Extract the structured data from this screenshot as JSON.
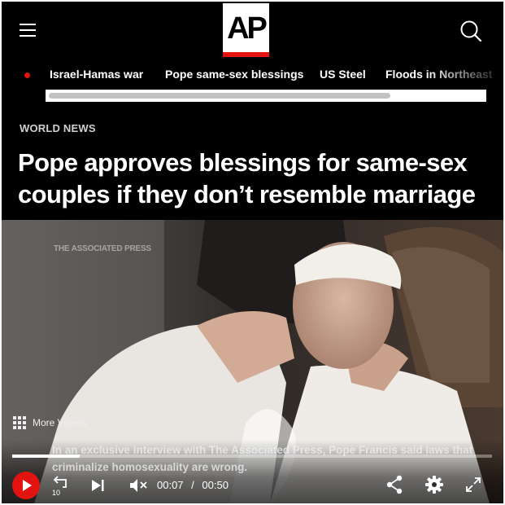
{
  "header": {
    "logo_text": "AP",
    "logo_accent": "#e3140f",
    "menu_icon": "hamburger-icon",
    "search_icon": "search-icon"
  },
  "trending": {
    "items": [
      "Israel-Hamas war",
      "Pope same-sex blessings",
      "US Steel",
      "Floods in Northeast"
    ]
  },
  "article": {
    "section": "WORLD NEWS",
    "headline": "Pope approves blessings for same-sex couples if they don’t resemble marriage"
  },
  "video": {
    "watermark": "THE ASSOCIATED PRESS",
    "more_videos": "More Videos",
    "caption": "In an exclusive interview with The Associated Press, Pope Francis said laws that criminalize homosexuality are wrong.",
    "current_time": "00:07",
    "separator": "/",
    "duration": "00:50",
    "progress": 0.14,
    "rewind_seconds": "10",
    "muted": true
  }
}
